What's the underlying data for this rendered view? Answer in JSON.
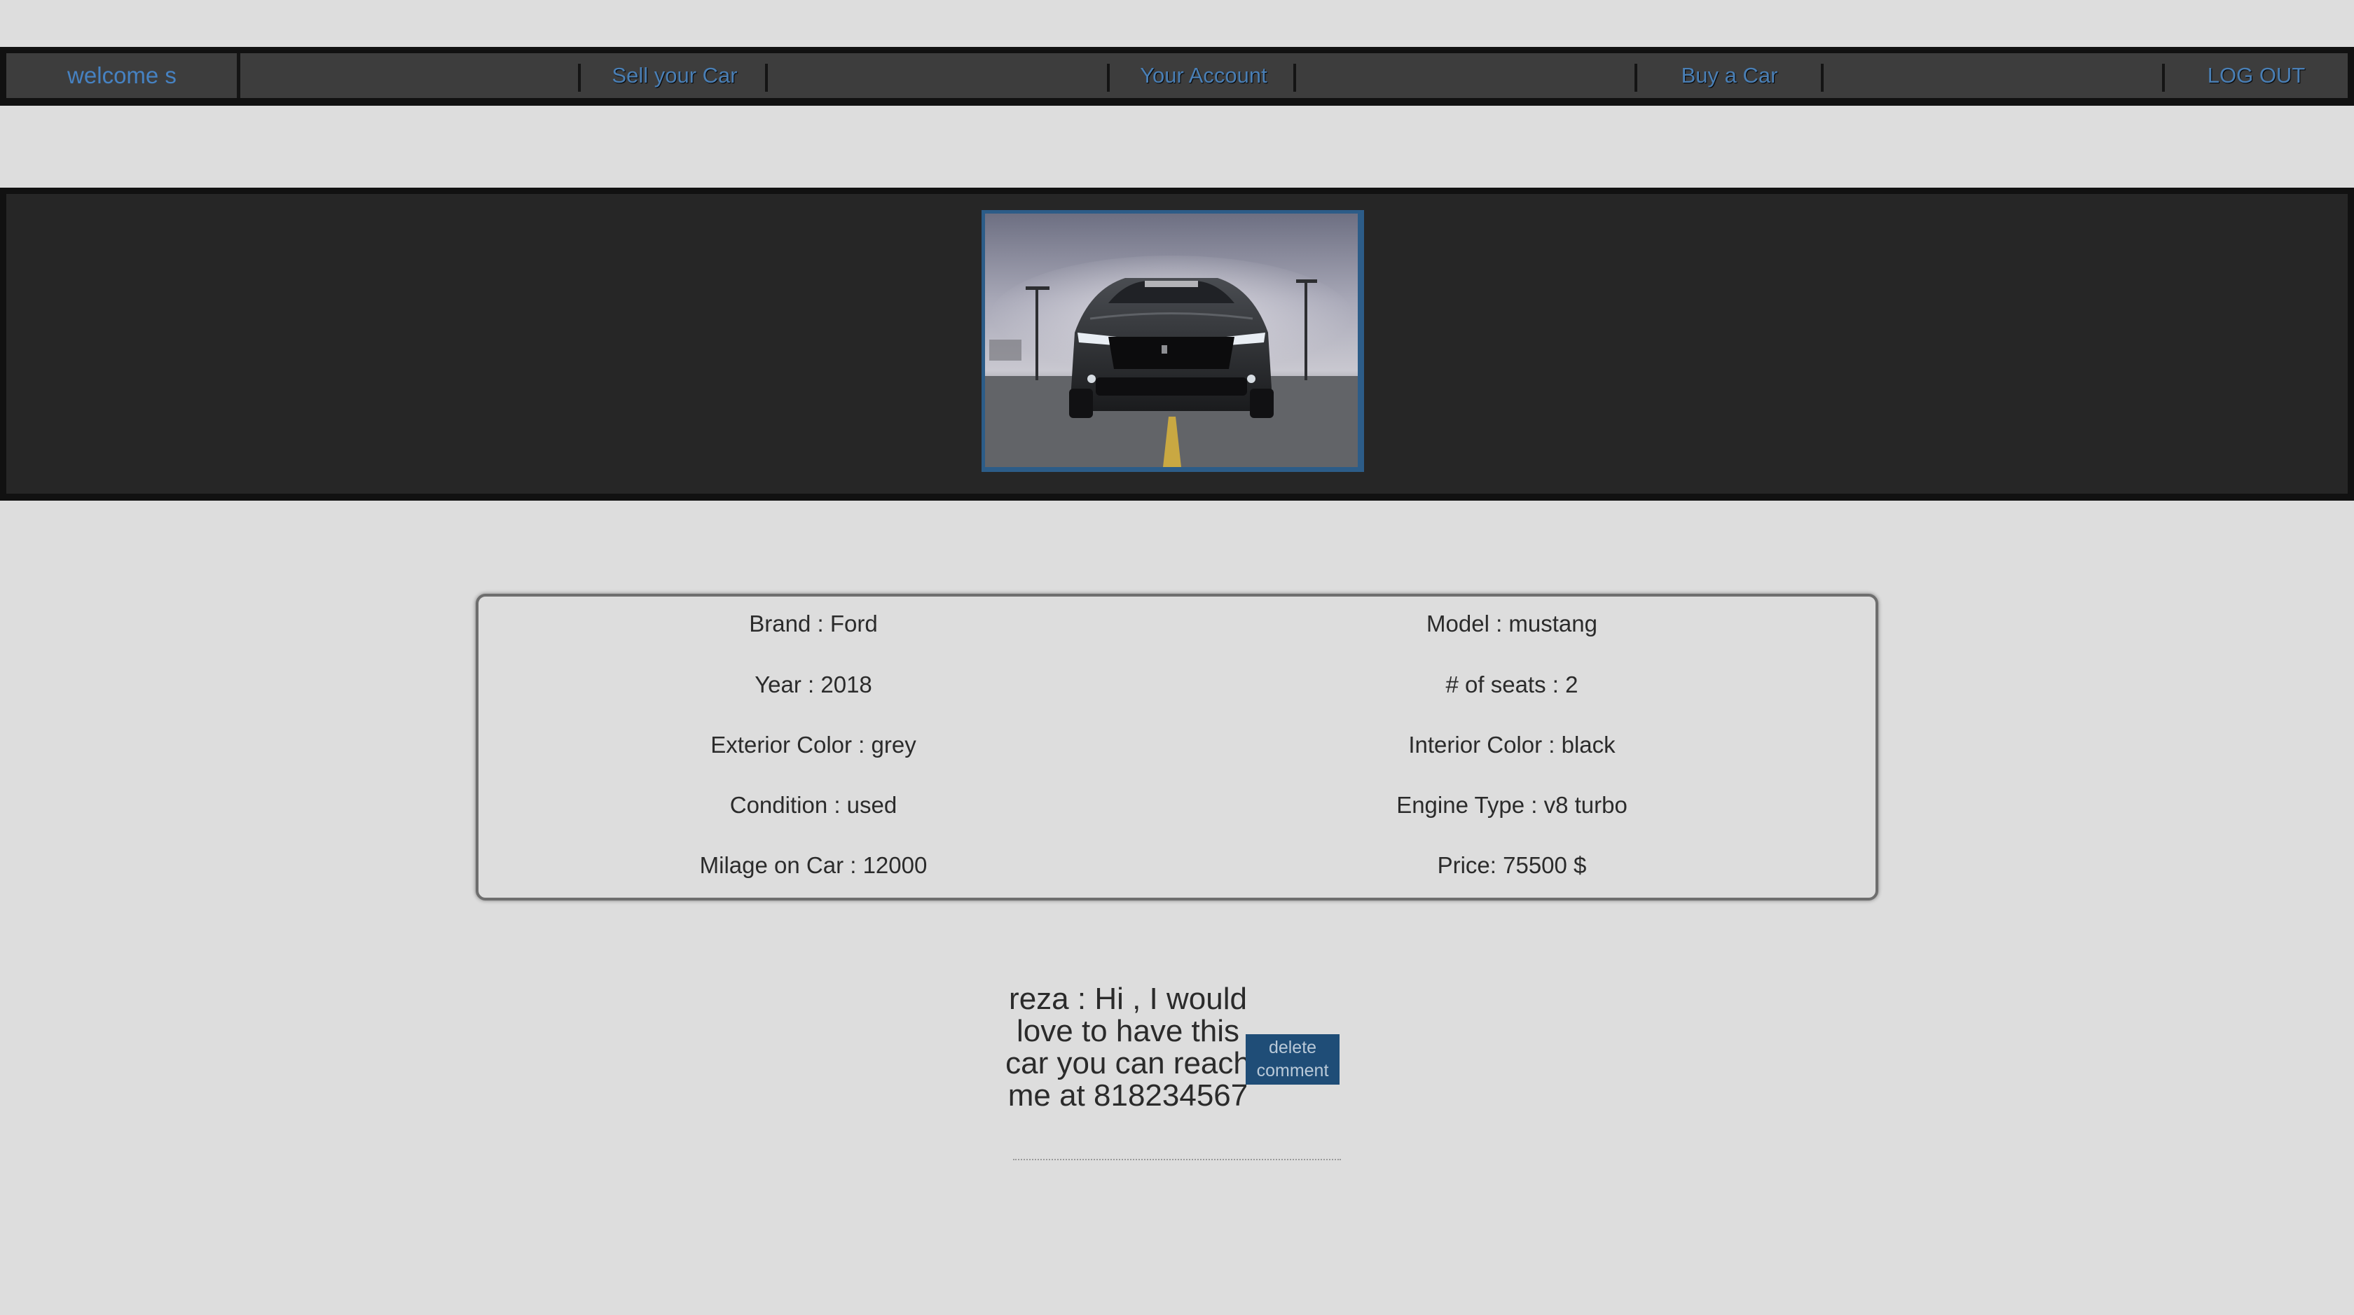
{
  "nav": {
    "welcome": "welcome s",
    "sell": "Sell your Car",
    "account": "Your Account",
    "buy": "Buy a Car",
    "logout": "LOG OUT"
  },
  "details": {
    "brand": "Brand : Ford",
    "model": "Model : mustang",
    "year": "Year : 2018",
    "seats": "# of seats : 2",
    "exterior_color": "Exterior Color : grey",
    "interior_color": "Interior Color : black",
    "condition": "Condition : used",
    "engine_type": "Engine Type : v8 turbo",
    "mileage": "Milage on Car : 12000",
    "price": "Price: 75500 $"
  },
  "comment": {
    "text": "reza : Hi , I would love to have this car you can reach me at 818234567",
    "delete_label": "delete comment"
  },
  "colors": {
    "page_background": "#dddddd",
    "nav_background": "#3d3d3d",
    "nav_link": "#4a7fb5",
    "hero_background": "#262626",
    "image_border": "#2c5c88",
    "delete_button": "#1f4d77"
  }
}
